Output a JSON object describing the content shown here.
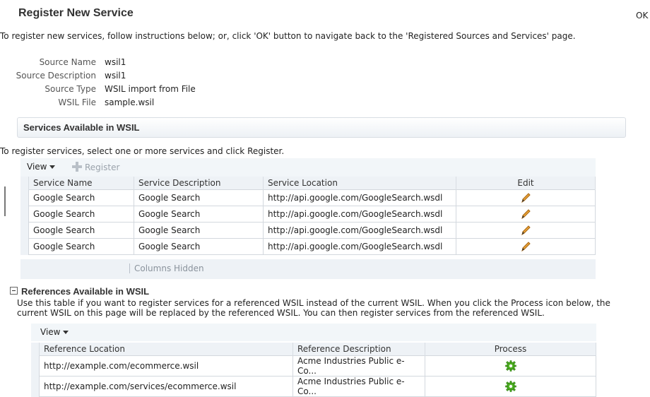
{
  "page": {
    "title": "Register New Service",
    "ok_label": "OK",
    "instructions": "To register new services, follow instructions below; or, click 'OK' button to navigate back to the 'Registered Sources and Services' page."
  },
  "source": {
    "name_label": "Source Name",
    "name_value": "wsil1",
    "desc_label": "Source Description",
    "desc_value": "wsil1",
    "type_label": "Source Type",
    "type_value": "WSIL import from File",
    "file_label": "WSIL File",
    "file_value": "sample.wsil"
  },
  "services_section": {
    "title": "Services Available in WSIL",
    "instructions": "To register services, select one or more services and click Register.",
    "toolbar": {
      "view_label": "View",
      "register_label": "Register"
    },
    "columns": [
      "Service Name",
      "Service Description",
      "Service Location",
      "Edit"
    ],
    "rows": [
      {
        "name": "Google Search",
        "description": "Google Search",
        "location": "http://api.google.com/GoogleSearch.wsdl"
      },
      {
        "name": "Google Search",
        "description": "Google Search",
        "location": "http://api.google.com/GoogleSearch.wsdl"
      },
      {
        "name": "Google Search",
        "description": "Google Search",
        "location": "http://api.google.com/GoogleSearch.wsdl"
      },
      {
        "name": "Google Search",
        "description": "Google Search",
        "location": "http://api.google.com/GoogleSearch.wsdl"
      }
    ],
    "columns_hidden_label": "Columns Hidden",
    "edit_icon": "pencil-icon"
  },
  "references_section": {
    "title": "References Available in WSIL",
    "description": "Use this table if you want to register services for a referenced WSIL instead of the current WSIL. When you click the Process icon below, the current WSIL on this page will be replaced by the referenced WSIL. You can then register services from the referenced WSIL.",
    "toolbar": {
      "view_label": "View"
    },
    "columns": [
      "Reference Location",
      "Reference Description",
      "Process"
    ],
    "rows": [
      {
        "location": "http://example.com/ecommerce.wsil",
        "description": "Acme Industries Public e-Co..."
      },
      {
        "location": "http://example.com/services/ecommerce.wsil",
        "description": "Acme Industries Public e-Co..."
      }
    ],
    "process_icon": "gear-icon"
  },
  "colors": {
    "pencil": "#c8861a",
    "gear": "#4caf1f",
    "header_bg": "#eef2f6"
  }
}
